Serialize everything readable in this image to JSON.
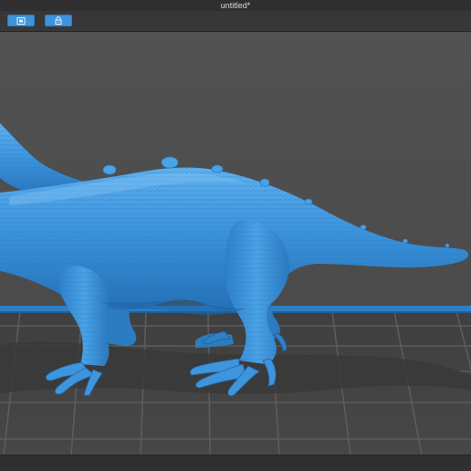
{
  "window": {
    "title": "untitled*"
  },
  "toolbar": {
    "buttons": [
      {
        "icon": "square-frame-icon"
      },
      {
        "icon": "lock-icon"
      }
    ],
    "accent": "#3d94dc"
  },
  "viewport": {
    "background": "#4b4b4b",
    "grid_color": "#5e5e5e",
    "build_plate_edge_color": "#2f7fc4",
    "model_color": "#3c95dd"
  }
}
